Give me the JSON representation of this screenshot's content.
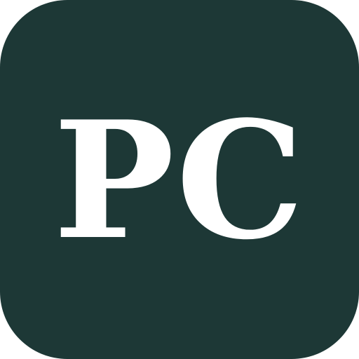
{
  "icon": {
    "monogram": "PC",
    "background_color": "#1d3836",
    "text_color": "#ffffff"
  }
}
